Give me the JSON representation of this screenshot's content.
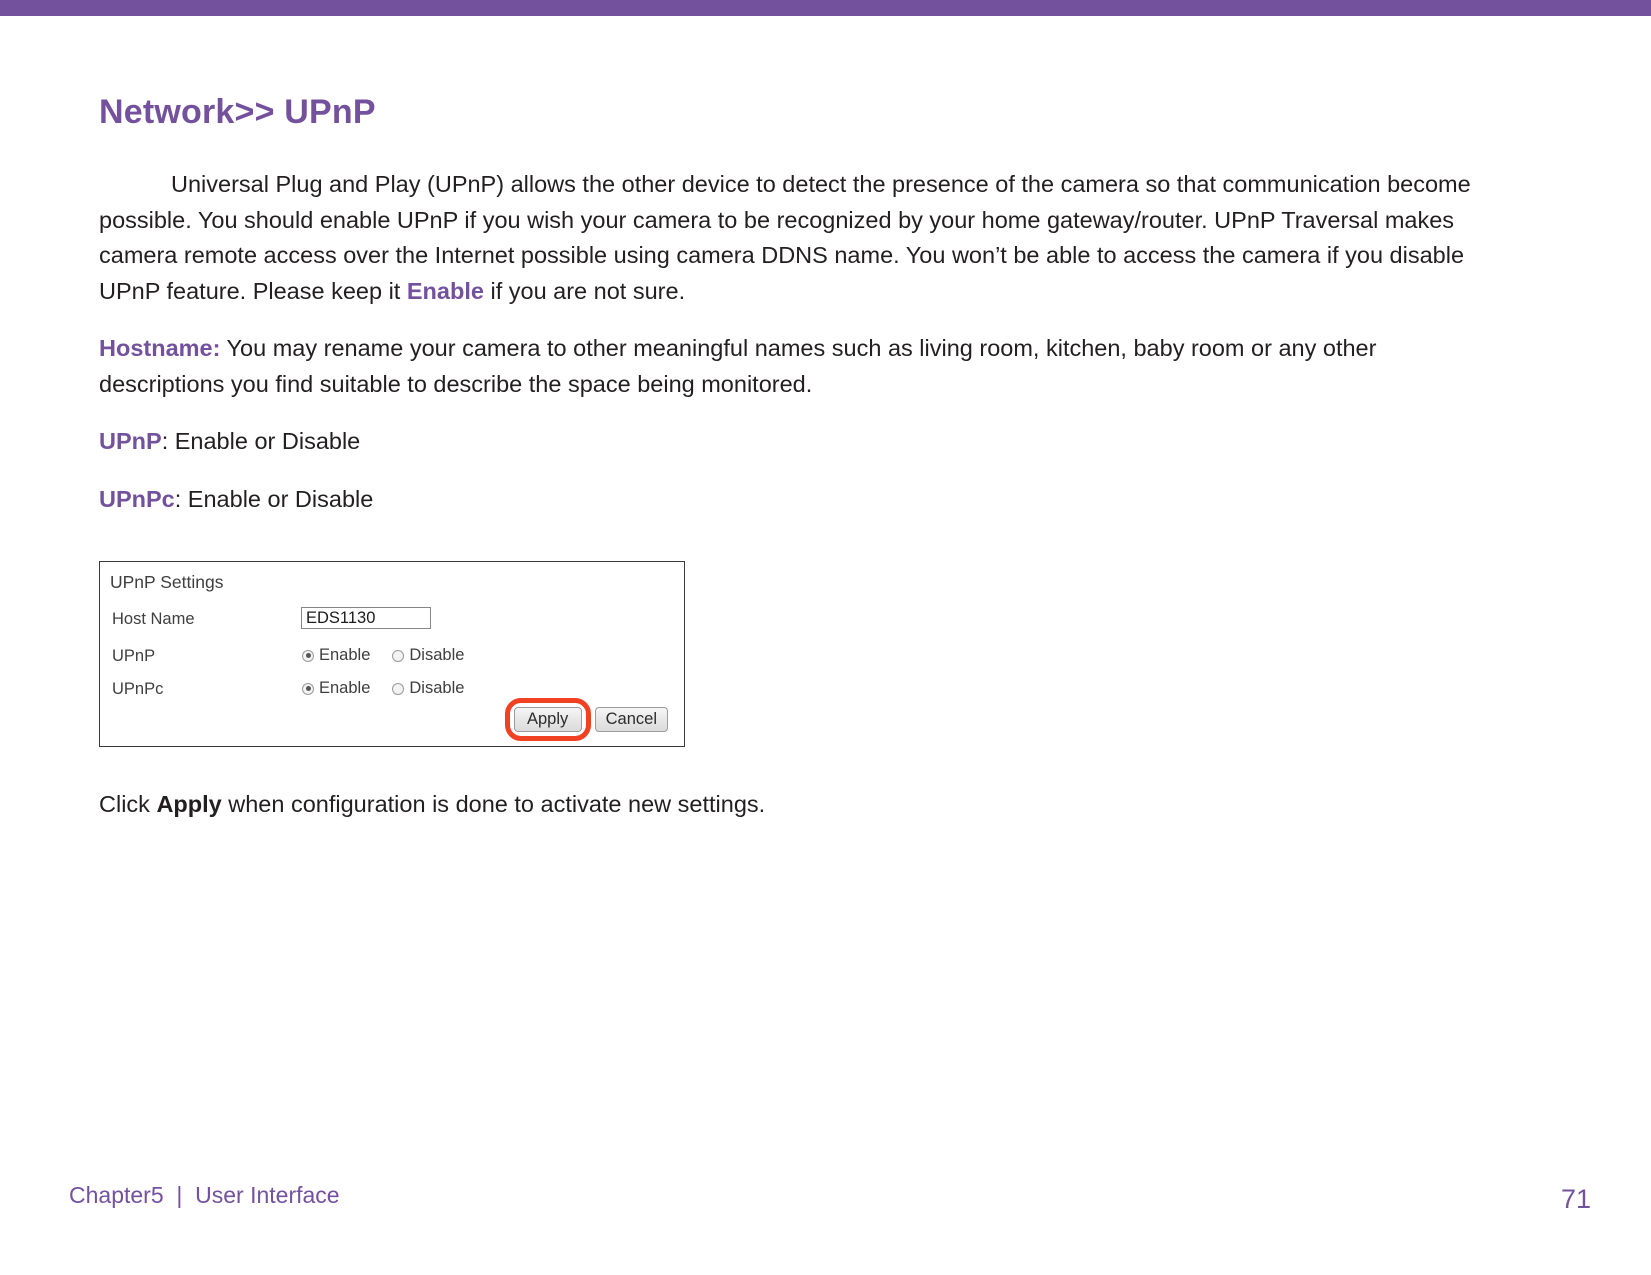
{
  "theme": {
    "accent": "#74519d",
    "text": "#231f20",
    "highlight_ring": "#f04122",
    "panel_border": "#3a3a3a"
  },
  "header": {
    "title": "Network>> UPnP"
  },
  "body": {
    "intro_lead": "Universal Plug and Play (UPnP) allows the other device to detect the presence of the camera so that communication become possible. You should enable UPnP if you wish your camera to be recognized by your home gateway/router. UPnP Traversal makes camera remote access over the Internet possible using camera DDNS name. You won’t be able to access the camera if you disable UPnP feature. Please keep it ",
    "intro_emphasis": "Enable",
    "intro_tail": " if you are not sure.",
    "hostname_label": "Hostname:",
    "hostname_text": " You may rename your camera to other meaningful names such as living room, kitchen, baby room or any other descriptions you find suitable to describe the space being monitored.",
    "upnp_label": "UPnP",
    "upnp_text": ": Enable or Disable",
    "upnpc_label": "UPnPc",
    "upnpc_text": ": Enable or Disable",
    "closing_prefix": "Click ",
    "closing_emphasis": "Apply",
    "closing_suffix": " when configuration is done to activate new settings."
  },
  "panel": {
    "title": "UPnP Settings",
    "rows": [
      {
        "label": "Host Name",
        "type": "text",
        "value": "EDS1130"
      },
      {
        "label": "UPnP",
        "type": "radio",
        "options": [
          "Enable",
          "Disable"
        ],
        "selected": "Enable"
      },
      {
        "label": "UPnPc",
        "type": "radio",
        "options": [
          "Enable",
          "Disable"
        ],
        "selected": "Enable"
      }
    ],
    "buttons": {
      "apply": "Apply",
      "cancel": "Cancel"
    }
  },
  "footer": {
    "chapter": "Chapter5  |  User Interface",
    "page_number": "71"
  }
}
